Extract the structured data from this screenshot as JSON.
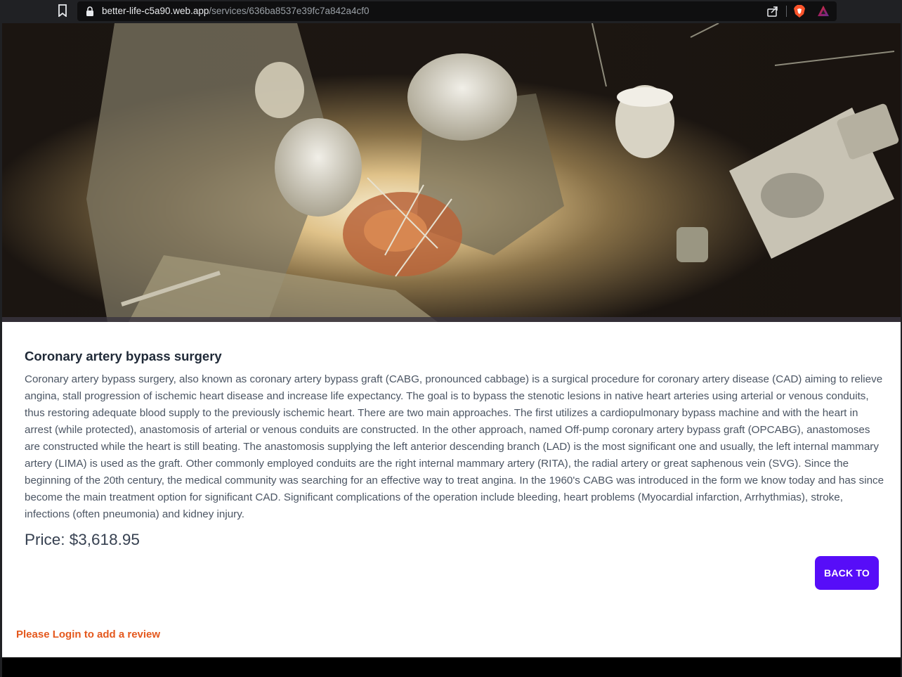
{
  "browser": {
    "url_host": "better-life-c5a90.web.app",
    "url_path": "/services/636ba8537e39fc7a842a4cf0"
  },
  "service": {
    "image_alt": "Surgeons performing coronary artery bypass surgery",
    "title": "Coronary artery bypass surgery",
    "description": "Coronary artery bypass surgery, also known as coronary artery bypass graft (CABG, pronounced cabbage) is a surgical procedure for coronary artery disease (CAD) aiming to relieve angina, stall progression of ischemic heart disease and increase life expectancy. The goal is to bypass the stenotic lesions in native heart arteries using arterial or venous conduits, thus restoring adequate blood supply to the previously ischemic heart. There are two main approaches. The first utilizes a cardiopulmonary bypass machine and with the heart in arrest (while protected), anastomosis of arterial or venous conduits are constructed. In the other approach, named Off-pump coronary artery bypass graft (OPCABG), anastomoses are constructed while the heart is still beating. The anastomosis supplying the left anterior descending branch (LAD) is the most significant one and usually, the left internal mammary artery (LIMA) is used as the graft. Other commonly employed conduits are the right internal mammary artery (RITA), the radial artery or great saphenous vein (SVG). Since the beginning of the 20th century, the medical community was searching for an effective way to treat angina. In the 1960's CABG was introduced in the form we know today and has since become the main treatment option for significant CAD. Significant complications of the operation include bleeding, heart problems (Myocardial infarction, Arrhythmias), stroke, infections (often pneumonia) and kidney injury.",
    "price": "Price: $3,618.95",
    "back_button_label": "BACK TO"
  },
  "reviews": {
    "login_prompt": "Please Login to add a review"
  },
  "colors": {
    "accent": "#570df8",
    "login_prompt": "#e4581d",
    "chrome_bg": "#202124"
  }
}
